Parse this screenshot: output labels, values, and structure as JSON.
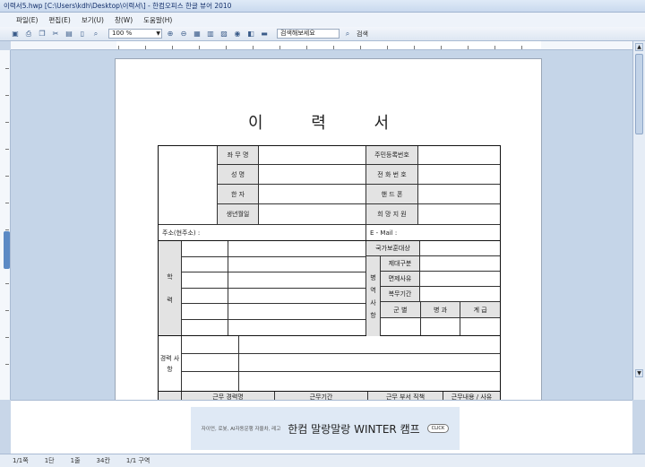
{
  "window": {
    "title": "이력서5.hwp [C:\\Users\\kdh\\Desktop\\이력서\\] - 한컴오피스 한글 뷰어 2010"
  },
  "menu": [
    "파일(E)",
    "편집(E)",
    "보기(U)",
    "창(W)",
    "도움말(H)"
  ],
  "toolbar": {
    "zoom": "100 %",
    "search_placeholder": "검색해보세요",
    "search_label": "검색"
  },
  "document": {
    "title": "이 력 서",
    "fields_left": [
      "좌 무 명",
      "성 명",
      "한 자",
      "생년월일"
    ],
    "fields_right": [
      "주민등록번호",
      "전 화 번 호",
      "핸 드 폰",
      "희 망 지 원"
    ],
    "address_label": "주소(현주소) :",
    "email_label": "E - Mail :",
    "veteran_label": "국가보훈대상",
    "education_label": "학 력",
    "military": {
      "label": "병 역 사 항",
      "rows": [
        "제대구분",
        "면제사유",
        "복무기간"
      ],
      "cols": [
        "군 별",
        "병 과",
        "계 급"
      ]
    },
    "career_label": "경력 사항",
    "bottom_cols": [
      "근무 경력명",
      "근무기간",
      "근무 부서 직책",
      "근무내용 / 사유"
    ]
  },
  "ad": {
    "small_text": "자이언, 로봇, AI자동운행 자율차, 레고",
    "headline": "한컴 말랑말랑 WINTER 캠프",
    "click": "CLICK"
  },
  "status": {
    "page": "1/1쪽",
    "section": "1단",
    "line": "1줄",
    "col": "34칸",
    "area": "1/1 구역"
  }
}
